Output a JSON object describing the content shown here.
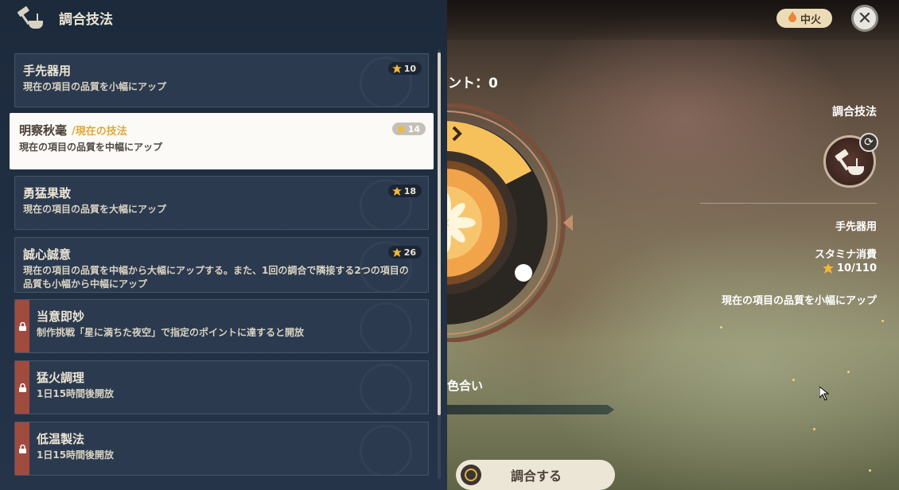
{
  "panel": {
    "title": "調合技法",
    "techniques": [
      {
        "name": "手先器用",
        "desc": "現在の項目の品質を小幅にアップ",
        "cost": "10",
        "state": "normal"
      },
      {
        "name": "明察秋毫",
        "current_tag": "/現在の技法",
        "desc": "現在の項目の品質を中幅にアップ",
        "cost": "14",
        "state": "selected"
      },
      {
        "name": "勇猛果敢",
        "desc": "現在の項目の品質を大幅にアップ",
        "cost": "18",
        "state": "normal"
      },
      {
        "name": "誠心誠意",
        "desc_line1": "現在の項目の品質を中幅から大幅にアップする。また、1回の調合で隣接する2つの項目の",
        "desc_line2": "品質も小幅から中幅にアップ",
        "cost": "26",
        "state": "normal"
      },
      {
        "name": "当意即妙",
        "desc": "制作挑戦「星に満ちた夜空」で指定のポイントに達すると開放",
        "state": "locked"
      },
      {
        "name": "猛火調理",
        "desc": "1日15時間後開放",
        "state": "locked"
      },
      {
        "name": "低温製法",
        "desc": "1日15時間後開放",
        "state": "locked"
      }
    ]
  },
  "scene": {
    "points_label": "ント：0",
    "color_match_label": "色合い",
    "heat_badge": "中火",
    "combine_button": "調合する"
  },
  "side": {
    "title": "調合技法",
    "technique_name": "手先器用",
    "stamina_label": "スタミナ消費",
    "stamina_value": "10/110",
    "technique_desc": "現在の項目の品質を小幅にアップ"
  },
  "colors": {
    "accent_gold": "#e0a838",
    "panel_bg": "#26344a",
    "lock_red": "#a14a3e",
    "dial_orange": "#f6c15a"
  },
  "icons": [
    "craft-hammer-icon",
    "swap-icon",
    "stamina-icon",
    "lock-icon",
    "close-icon",
    "flame-icon"
  ]
}
